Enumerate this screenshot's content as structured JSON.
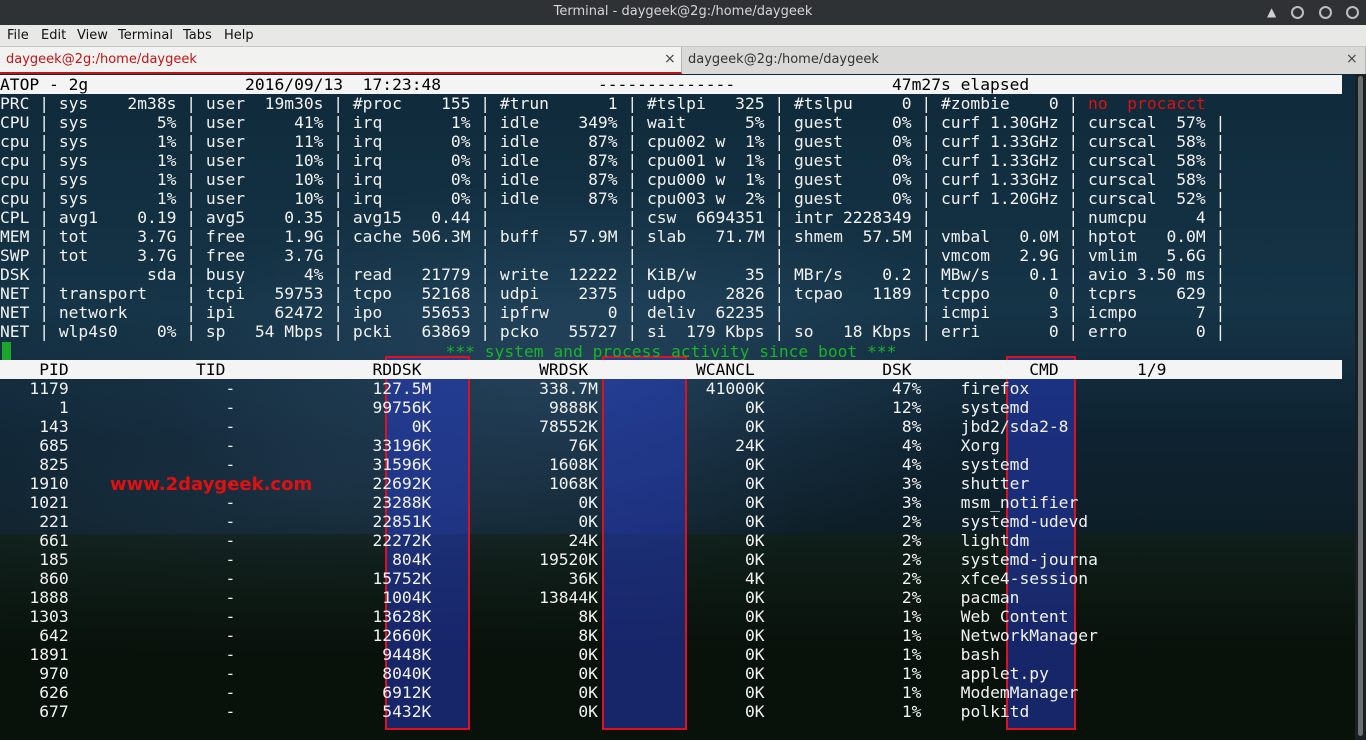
{
  "window": {
    "title": "Terminal - daygeek@2g:/home/daygeek"
  },
  "menu": [
    "File",
    "Edit",
    "View",
    "Terminal",
    "Tabs",
    "Help"
  ],
  "tabs": [
    {
      "label": "daygeek@2g:/home/daygeek",
      "close": "×"
    },
    {
      "label": "daygeek@2g:/home/daygeek",
      "close": "×"
    }
  ],
  "atop": {
    "header": "ATOP - 2g                2016/09/13  17:23:48                --------------                47m27s elapsed"
  },
  "stats": [
    {
      "text": "PRC | sys    2m38s | user  19m30s | #proc    155 | #trun      1 | #tslpi   325 | #tslpu     0 | #zombie    0 | ",
      "tail": "no  procacct"
    },
    {
      "text": "CPU | sys       5% | user     41% | irq       1% | idle    349% | wait      5% | guest     0% | curf 1.30GHz | curscal  57% |"
    },
    {
      "text": "cpu | sys       1% | user     11% | irq       0% | idle     87% | cpu002 w  1% | guest     0% | curf 1.33GHz | curscal  58% |"
    },
    {
      "text": "cpu | sys       1% | user     10% | irq       0% | idle     87% | cpu001 w  1% | guest     0% | curf 1.33GHz | curscal  58% |"
    },
    {
      "text": "cpu | sys       1% | user     10% | irq       0% | idle     87% | cpu000 w  1% | guest     0% | curf 1.33GHz | curscal  58% |"
    },
    {
      "text": "cpu | sys       1% | user     10% | irq       0% | idle     87% | cpu003 w  2% | guest     0% | curf 1.20GHz | curscal  52% |"
    },
    {
      "text": "CPL | avg1    0.19 | avg5    0.35 | avg15   0.44 |              | csw  6694351 | intr 2228349 |              | numcpu     4 |"
    },
    {
      "text": "MEM | tot     3.7G | free    1.9G | cache 506.3M | buff   57.9M | slab   71.7M | shmem  57.5M | vmbal   0.0M | hptot   0.0M |"
    },
    {
      "text": "SWP | tot     3.7G | free    3.7G |              |              |              |              | vmcom   2.9G | vmlim   5.6G |"
    },
    {
      "text": "DSK |          sda | busy      4% | read   21779 | write  12222 | KiB/w     35 | MBr/s    0.2 | MBw/s    0.1 | avio 3.50 ms |"
    },
    {
      "text": "NET | transport    | tcpi   59753 | tcpo   52168 | udpi    2375 | udpo    2826 | tcpao   1189 | tcppo      0 | tcprs    629 |"
    },
    {
      "text": "NET | network      | ipi    62472 | ipo    55653 | ipfrw      0 | deliv  62235 |              | icmpi      3 | icmpo      7 |"
    },
    {
      "text": "NET | wlp4s0    0% | sp   54 Mbps | pcki   63869 | pcko   55727 | si  179 Kbps | so   18 Kbps | erri       0 | erro       0 |"
    }
  ],
  "banner": "*** system and process activity since boot ***",
  "table": {
    "header": "    PID             TID               RDDSK            WRDSK           WCANCL             DSK            CMD        1/9",
    "rows": [
      [
        "1179",
        "-",
        "127.5M",
        "338.7M",
        "41000K",
        "47%",
        "firefox"
      ],
      [
        "1",
        "-",
        "99756K",
        "9888K",
        "0K",
        "12%",
        "systemd"
      ],
      [
        "143",
        "-",
        "0K",
        "78552K",
        "0K",
        "8%",
        "jbd2/sda2-8"
      ],
      [
        "685",
        "-",
        "33196K",
        "76K",
        "24K",
        "4%",
        "Xorg"
      ],
      [
        "825",
        "-",
        "31596K",
        "1608K",
        "0K",
        "4%",
        "systemd"
      ],
      [
        "1910",
        "-",
        "22692K",
        "1068K",
        "0K",
        "3%",
        "shutter"
      ],
      [
        "1021",
        "-",
        "23288K",
        "0K",
        "0K",
        "3%",
        "msm_notifier"
      ],
      [
        "221",
        "-",
        "22851K",
        "0K",
        "0K",
        "2%",
        "systemd-udevd"
      ],
      [
        "661",
        "-",
        "22272K",
        "24K",
        "0K",
        "2%",
        "lightdm"
      ],
      [
        "185",
        "-",
        "804K",
        "19520K",
        "0K",
        "2%",
        "systemd-journa"
      ],
      [
        "860",
        "-",
        "15752K",
        "36K",
        "4K",
        "2%",
        "xfce4-session"
      ],
      [
        "1888",
        "-",
        "1004K",
        "13844K",
        "0K",
        "2%",
        "pacman"
      ],
      [
        "1303",
        "-",
        "13628K",
        "8K",
        "0K",
        "1%",
        "Web Content"
      ],
      [
        "642",
        "-",
        "12660K",
        "8K",
        "0K",
        "1%",
        "NetworkManager"
      ],
      [
        "1891",
        "-",
        "9448K",
        "0K",
        "0K",
        "1%",
        "bash"
      ],
      [
        "970",
        "-",
        "8040K",
        "0K",
        "0K",
        "1%",
        "applet.py"
      ],
      [
        "626",
        "-",
        "6912K",
        "0K",
        "0K",
        "1%",
        "ModemManager"
      ],
      [
        "677",
        "-",
        "5432K",
        "0K",
        "0K",
        "1%",
        "polkitd"
      ]
    ]
  },
  "watermark": "www.2daygeek.com",
  "colors": {
    "highlight_box": "#e0101e",
    "box_fill": "#2a3ccf",
    "banner": "#1ab326",
    "alert": "#d11111"
  }
}
